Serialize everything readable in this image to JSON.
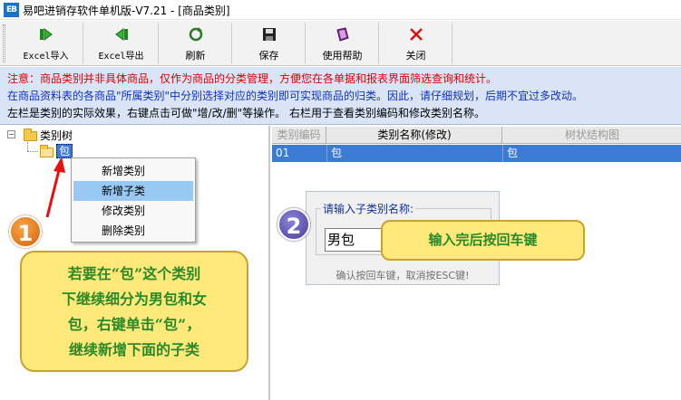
{
  "window": {
    "app_icon_text": "EB",
    "title": "易吧进销存软件单机版-V7.21 - [商品类别]"
  },
  "toolbar": {
    "items": [
      {
        "label": "Excel导入",
        "icon": "excel-import-icon"
      },
      {
        "label": "Excel导出",
        "icon": "excel-export-icon"
      },
      {
        "label": "刷新",
        "icon": "refresh-icon"
      },
      {
        "label": "保存",
        "icon": "save-icon"
      },
      {
        "label": "使用帮助",
        "icon": "help-book-icon"
      },
      {
        "label": "关闭",
        "icon": "close-icon"
      }
    ]
  },
  "notice": {
    "line1": "注意：商品类别并非具体商品，仅作为商品的分类管理，方便您在各单据和报表界面筛选查询和统计。",
    "line2": "在商品资料表的各商品\"所属类别\"中分别选择对应的类别即可实现商品的归类。因此，请仔细规划，后期不宜过多改动。",
    "line3": "左栏是类别的实际效果，右键点击可做\"增/改/删\"等操作。  右栏用于查看类别编码和修改类别名称。",
    "colors": {
      "line1": "#e00000",
      "line2": "#1030c8",
      "line3": "#000000"
    }
  },
  "tree": {
    "root_label": "类别树",
    "expander": "−",
    "child_label": "包"
  },
  "context_menu": {
    "items": [
      {
        "label": "新增类别",
        "highlighted": false
      },
      {
        "label": "新增子类",
        "highlighted": true
      },
      {
        "label": "修改类别",
        "highlighted": false
      },
      {
        "label": "删除类别",
        "highlighted": false
      }
    ]
  },
  "grid": {
    "columns": [
      "类别编码",
      "类别名称(修改)",
      "树状结构图"
    ],
    "rows": [
      {
        "code": "01",
        "name": "包",
        "tree": "包"
      }
    ]
  },
  "dialog": {
    "label": "请输入子类别名称:",
    "input_value": "男包",
    "hint": "确认按回车键，取消按ESC键!"
  },
  "annotations": {
    "badge1": "1",
    "badge2": "2",
    "callout1_lines": [
      "若要在“包”这个类别",
      "下继续细分为男包和女",
      "包，右键单击“包”，",
      "继续新增下面的子类"
    ],
    "callout2": "输入完后按回车键"
  }
}
